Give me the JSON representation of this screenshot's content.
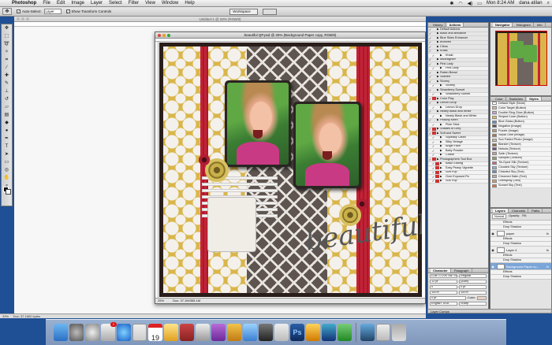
{
  "menubar": {
    "apple": "",
    "items": [
      "Photoshop",
      "File",
      "Edit",
      "Image",
      "Layer",
      "Select",
      "Filter",
      "View",
      "Window",
      "Help"
    ],
    "clock": "Mon 8:24 AM",
    "user": "dana atilan"
  },
  "options_bar": {
    "auto_select_label": "Auto-Select:",
    "auto_select_value": "Layer",
    "show_transform_label": "Show Transform Controls",
    "workspace_label": "Workspace"
  },
  "background_document": {
    "title": "Untitled-1 @ 33% (RGB/8)"
  },
  "document": {
    "title": "beautiful QP.psd @ 25% (Background Paper copy, RGB/8)",
    "zoom": "25%",
    "doc_size": "Doc: 37.1M/355.1M"
  },
  "left_status": {
    "zoom": "33%",
    "doc_size": "Doc: 37.1M/0 bytes"
  },
  "scrapbook": {
    "word_art": "beautiful"
  },
  "actions_panel": {
    "tabs": [
      "History",
      "Actions"
    ],
    "rows": [
      {
        "label": "Default Actions",
        "kind": "set",
        "dialog": false
      },
      {
        "label": "Black and Brilliance",
        "kind": "set",
        "dialog": false
      },
      {
        "label": "Blue Skies Enhancer",
        "kind": "set",
        "dialog": false
      },
      {
        "label": "Bronzes",
        "kind": "set",
        "dialog": false
      },
      {
        "label": "Citrus",
        "kind": "set",
        "dialog": false
      },
      {
        "label": "Khaki",
        "kind": "set",
        "dialog": false
      },
      {
        "label": "Khaki",
        "kind": "item",
        "dialog": false
      },
      {
        "label": "Moonlighter",
        "kind": "set",
        "dialog": false
      },
      {
        "label": "Pink Lady",
        "kind": "set",
        "dialog": false
      },
      {
        "label": "Pink Lady",
        "kind": "item",
        "dialog": false
      },
      {
        "label": "Raisin Bread",
        "kind": "set",
        "dialog": false
      },
      {
        "label": "Scarlett",
        "kind": "set",
        "dialog": false
      },
      {
        "label": "Stormy",
        "kind": "set",
        "dialog": false
      },
      {
        "label": "Stormy",
        "kind": "item",
        "dialog": false
      },
      {
        "label": "Strawberry Sunset",
        "kind": "set",
        "dialog": false
      },
      {
        "label": "Strawberry Sunset",
        "kind": "item",
        "dialog": false
      },
      {
        "label": "Color Play",
        "kind": "set",
        "dialog": true
      },
      {
        "label": "Lemon Drop",
        "kind": "set",
        "dialog": false
      },
      {
        "label": "Lemon Drop",
        "kind": "item",
        "dialog": false
      },
      {
        "label": "Nearly Black and White",
        "kind": "set",
        "dialog": false
      },
      {
        "label": "Nearly Black and White",
        "kind": "item",
        "dialog": false
      },
      {
        "label": "Peachy Keen",
        "kind": "set",
        "dialog": false
      },
      {
        "label": "Pixie Stick",
        "kind": "item",
        "dialog": false
      },
      {
        "label": "Shades of Grey",
        "kind": "set",
        "dialog": true
      },
      {
        "label": "Soft and Sweet",
        "kind": "set",
        "dialog": true
      },
      {
        "label": "Squeaky Clean",
        "kind": "item",
        "dialog": false
      },
      {
        "label": "Silky Vintage",
        "kind": "item",
        "dialog": false
      },
      {
        "label": "Angel Face",
        "kind": "item",
        "dialog": false
      },
      {
        "label": "Baby Powder",
        "kind": "item",
        "dialog": false
      },
      {
        "label": "Cotton",
        "kind": "item",
        "dialog": false
      },
      {
        "label": "Photographers Tool Box",
        "kind": "set",
        "dialog": true
      },
      {
        "label": "Basic Editing",
        "kind": "item",
        "dialog": true
      },
      {
        "label": "Easy Peasy Vignette",
        "kind": "item",
        "dialog": true
      },
      {
        "label": "Soft Pop",
        "kind": "item",
        "dialog": true
      },
      {
        "label": "Over Exposed Fix",
        "kind": "item",
        "dialog": true
      },
      {
        "label": "Sun Pop",
        "kind": "item",
        "dialog": true
      }
    ]
  },
  "navigator_panel": {
    "tabs": [
      "Navigator",
      "Histogram",
      "Info"
    ]
  },
  "styles_panel": {
    "tabs": [
      "Color",
      "Swatches",
      "Styles"
    ],
    "rows": [
      {
        "label": "Default Style (None)",
        "color": "#ffffff"
      },
      {
        "label": "Color Target (Button)",
        "color": "#d8b9a0"
      },
      {
        "label": "Double Ring Glow (Button)",
        "color": "#c9a0d8"
      },
      {
        "label": "Striped Cone (Button)",
        "color": "#e0c050"
      },
      {
        "label": "Blue Glass (Button)",
        "color": "#5a8fd0"
      },
      {
        "label": "Negative (Image)",
        "color": "#555555"
      },
      {
        "label": "Puzzle (Image)",
        "color": "#b0a080"
      },
      {
        "label": "Sepia Tone (Image)",
        "color": "#a07850"
      },
      {
        "label": "Sun Faded Photo (Image)",
        "color": "#c8c0a0"
      },
      {
        "label": "Blanket (Texture)",
        "color": "#8c6a4a"
      },
      {
        "label": "Nebula (Texture)",
        "color": "#6a4a8c"
      },
      {
        "label": "Satin (Texture)",
        "color": "#c0a0a0"
      },
      {
        "label": "Sampler (Texture)",
        "color": "#8ca060"
      },
      {
        "label": "Tie-Dyed Silk (Texture)",
        "color": "#d06090"
      },
      {
        "label": "Clouded Sky (Texture)",
        "color": "#90b0d8"
      },
      {
        "label": "Chiseled Sky (Text)",
        "color": "#6090c0"
      },
      {
        "label": "Chromed Satin (Text)",
        "color": "#b0b0b0"
      },
      {
        "label": "Overspray (Text)",
        "color": "#d0a060"
      },
      {
        "label": "Sunset Sky (Text)",
        "color": "#e07040"
      }
    ]
  },
  "layers_panel": {
    "tabs": [
      "Layers",
      "Channels",
      "Paths"
    ],
    "blend_mode": "Normal",
    "opacity_label": "Opacity:",
    "fill_label": "Fill:",
    "rows": [
      {
        "label": "Effects",
        "kind": "sub"
      },
      {
        "label": "Drop Shadow",
        "kind": "sub"
      },
      {
        "label": "paper",
        "kind": "layer"
      },
      {
        "label": "Effects",
        "kind": "sub"
      },
      {
        "label": "Drop Shadow",
        "kind": "sub"
      },
      {
        "label": "Layer 4",
        "kind": "layer"
      },
      {
        "label": "Effects",
        "kind": "sub"
      },
      {
        "label": "Drop Shadow",
        "kind": "sub"
      },
      {
        "label": "Background Paper co...",
        "kind": "layer-selected"
      },
      {
        "label": "Effects",
        "kind": "sub"
      },
      {
        "label": "Drop Shadow",
        "kind": "sub"
      }
    ]
  },
  "character_panel": {
    "tabs": [
      "Character",
      "Paragraph"
    ],
    "font": "DJB I LOVE ME SO...",
    "style": "Regular",
    "size": "12 pt",
    "leading": "(Auto)",
    "tracking": "0 pt",
    "kerning": "0",
    "vscale": "100%",
    "hscale": "100%",
    "baseline": "0 pt",
    "color_label": "Color:",
    "language": "English: USA",
    "aa": "Sharp"
  },
  "layer_comps": {
    "label": "Layer Comps"
  },
  "dock": {
    "mail_badge": "2",
    "calendar_day": "19"
  },
  "colors": {
    "desktop": "#1f4f94",
    "accent_selected": "#7aa5d8"
  }
}
